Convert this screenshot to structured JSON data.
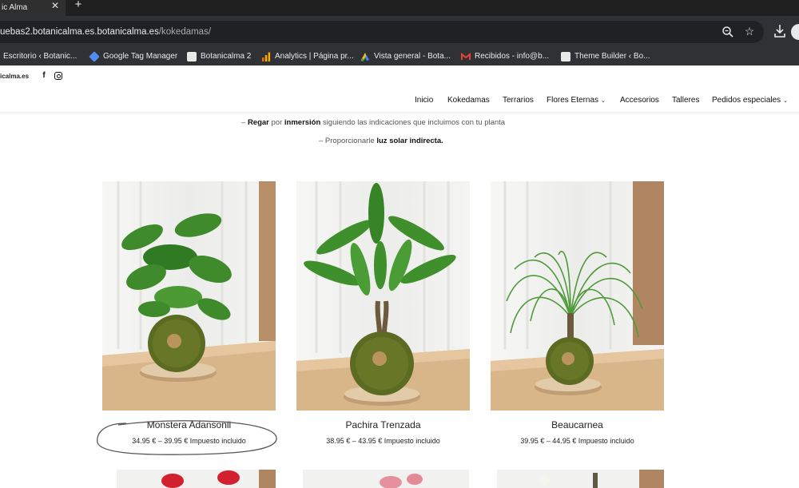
{
  "browser": {
    "tab_title": "ic Alma",
    "url_host": "uebas2.botanicalma.es.botanicalma.es",
    "url_path": "/kokedamas/",
    "bookmarks": [
      {
        "label": "Escritorio ‹ Botanic...",
        "icon": "wordpress-icon",
        "color": "#3c3c3c"
      },
      {
        "label": "Google Tag Manager",
        "icon": "gtm-icon",
        "color": "#4f8df5"
      },
      {
        "label": "Botanicalma 2",
        "icon": "site-icon",
        "color": "#e8e8e8"
      },
      {
        "label": "Analytics | Página pr...",
        "icon": "analytics-icon",
        "color": "#f9ab00"
      },
      {
        "label": "Vista general - Bota...",
        "icon": "google-ads-icon",
        "color": "#4285f4"
      },
      {
        "label": "Recibidos - info@b...",
        "icon": "gmail-icon",
        "color": "#ea4335"
      },
      {
        "label": "Theme Builder ‹ Bo...",
        "icon": "site-icon",
        "color": "#e8e8e8"
      }
    ]
  },
  "site": {
    "domain": "icalma.es",
    "nav": [
      {
        "label": "Inicio",
        "has_dropdown": false
      },
      {
        "label": "Kokedamas",
        "has_dropdown": false
      },
      {
        "label": "Terrarios",
        "has_dropdown": false
      },
      {
        "label": "Flores Eternas",
        "has_dropdown": true
      },
      {
        "label": "Accesorios",
        "has_dropdown": false
      },
      {
        "label": "Talleres",
        "has_dropdown": false
      },
      {
        "label": "Pedidos especiales",
        "has_dropdown": true
      }
    ],
    "care": {
      "line1_prefix": "– ",
      "line1_bold1": "Regar",
      "line1_mid": " por ",
      "line1_bold2": "inmersión",
      "line1_suffix": " siguiendo las indicaciones que incluimos con tu planta",
      "line2_prefix": "– Proporcionarle ",
      "line2_bold": "luz solar indirecta."
    }
  },
  "products": [
    {
      "name": "Monstera Adansonii",
      "price": "34.95 € – 39.95 € Impuesto incluido"
    },
    {
      "name": "Pachira Trenzada",
      "price": "38.95 € – 43.95 € Impuesto incluido"
    },
    {
      "name": "Beaucarnea",
      "price": "39.95 € – 44.95 € Impuesto incluido"
    }
  ],
  "colors": {
    "tabstrip": "#1f1f1f",
    "toolbar": "#303134",
    "omnibox": "#202124",
    "annotation": "#555555"
  }
}
